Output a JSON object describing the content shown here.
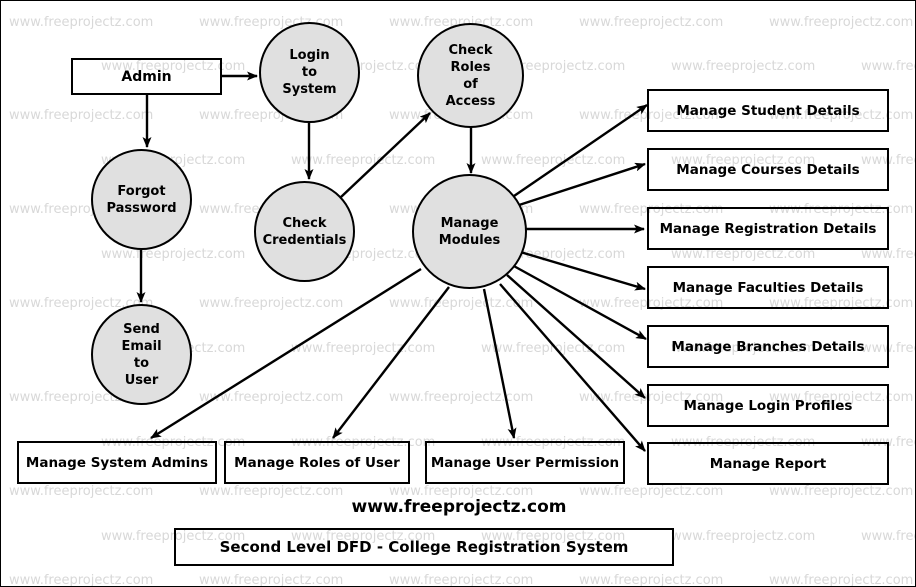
{
  "diagram": {
    "title": "Second Level DFD - College Registration System",
    "brand": "www.freeprojectz.com",
    "watermark_text": "www.freeprojectz.com",
    "colors": {
      "process_fill": "#e0e0e0",
      "stroke": "#000000",
      "watermark": "#d8d8d8",
      "background": "#ffffff"
    }
  },
  "entities": [
    {
      "id": "admin",
      "label": "Admin"
    }
  ],
  "processes": [
    {
      "id": "login_to_system",
      "label": "Login\nto\nSystem"
    },
    {
      "id": "check_roles_of_access",
      "label": "Check\nRoles\nof\nAccess"
    },
    {
      "id": "forgot_password",
      "label": "Forgot\nPassword"
    },
    {
      "id": "check_credentials",
      "label": "Check\nCredentials"
    },
    {
      "id": "manage_modules",
      "label": "Manage\nModules"
    },
    {
      "id": "send_email_to_user",
      "label": "Send\nEmail\nto\nUser"
    }
  ],
  "right_modules": [
    {
      "id": "manage_student_details",
      "label": "Manage Student Details"
    },
    {
      "id": "manage_courses_details",
      "label": "Manage Courses Details"
    },
    {
      "id": "manage_registration_details",
      "label": "Manage Registration Details"
    },
    {
      "id": "manage_faculties_details",
      "label": "Manage Faculties Details"
    },
    {
      "id": "manage_branches_details",
      "label": "Manage Branches Details"
    },
    {
      "id": "manage_login_profiles",
      "label": "Manage Login Profiles"
    },
    {
      "id": "manage_report",
      "label": "Manage Report"
    }
  ],
  "bottom_modules": [
    {
      "id": "manage_system_admins",
      "label": "Manage System Admins"
    },
    {
      "id": "manage_roles_of_user",
      "label": "Manage Roles of User"
    },
    {
      "id": "manage_user_permission",
      "label": "Manage User Permission"
    }
  ],
  "flows": [
    {
      "from": "admin",
      "to": "login_to_system"
    },
    {
      "from": "admin",
      "to": "forgot_password"
    },
    {
      "from": "login_to_system",
      "to": "check_credentials"
    },
    {
      "from": "forgot_password",
      "to": "send_email_to_user"
    },
    {
      "from": "check_credentials",
      "to": "check_roles_of_access"
    },
    {
      "from": "check_roles_of_access",
      "to": "manage_modules"
    },
    {
      "from": "manage_modules",
      "to": "manage_student_details"
    },
    {
      "from": "manage_modules",
      "to": "manage_courses_details"
    },
    {
      "from": "manage_modules",
      "to": "manage_registration_details"
    },
    {
      "from": "manage_modules",
      "to": "manage_faculties_details"
    },
    {
      "from": "manage_modules",
      "to": "manage_branches_details"
    },
    {
      "from": "manage_modules",
      "to": "manage_login_profiles"
    },
    {
      "from": "manage_modules",
      "to": "manage_report"
    },
    {
      "from": "manage_modules",
      "to": "manage_system_admins"
    },
    {
      "from": "manage_modules",
      "to": "manage_roles_of_user"
    },
    {
      "from": "manage_modules",
      "to": "manage_user_permission"
    }
  ]
}
